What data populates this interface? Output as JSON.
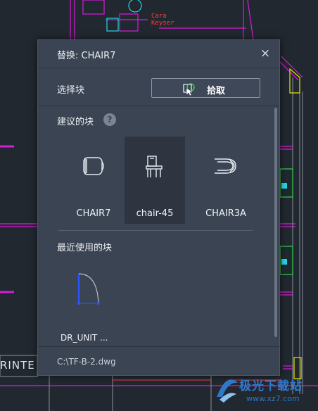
{
  "cad": {
    "person_name": [
      "Cara",
      "Keyser"
    ],
    "printer_text": "RINTE"
  },
  "dialog": {
    "title": "替换: CHAIR7",
    "close_glyph": "×",
    "select_label": "选择块",
    "pick_button_label": "拾取",
    "suggested_title": "建议的块",
    "help_glyph": "?",
    "suggested_blocks": [
      {
        "label": "CHAIR7",
        "icon": "chair-top-view-icon",
        "selected": false
      },
      {
        "label": "chair-45",
        "icon": "chair-side-view-icon",
        "selected": true
      },
      {
        "label": "CHAIR3A",
        "icon": "chair-rotated-view-icon",
        "selected": false
      }
    ],
    "recent_title": "最近使用的块",
    "recent_blocks": [
      {
        "label": "DR_UNIT ...",
        "icon": "door-unit-icon"
      }
    ],
    "file_path": "C:\\TF-B-2.dwg"
  },
  "watermark": {
    "text": "极光下载站",
    "url": "www.xz7.com"
  },
  "colors": {
    "dialog_bg": "#3b4453",
    "cad_bg": "#212830",
    "cad_magenta": "#d81cd8",
    "cad_cyan": "#27d5e6",
    "cad_red": "#ff3b3b",
    "cad_green": "#2fd64a",
    "door_blue": "#2b55ff",
    "watermark_blue": "#2f78c9"
  }
}
